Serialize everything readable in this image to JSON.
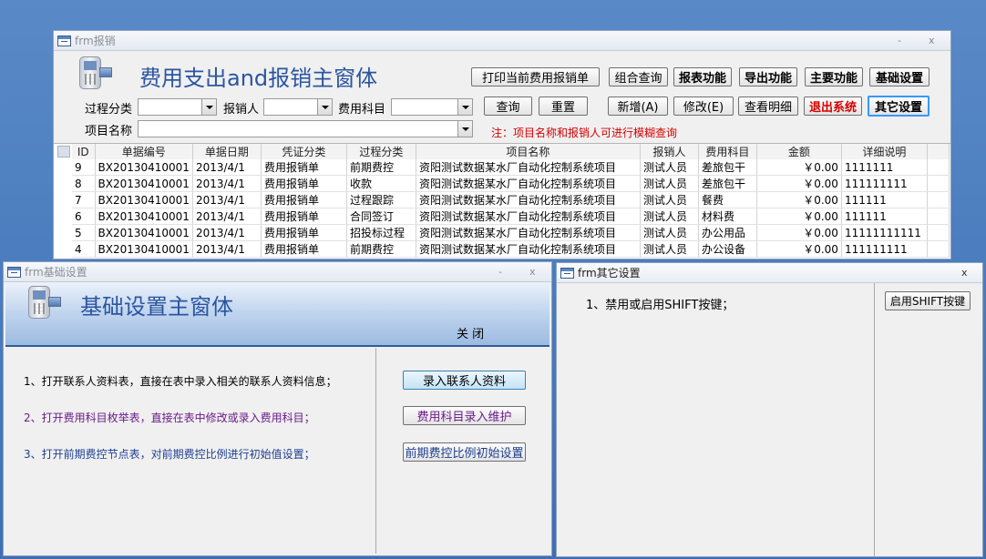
{
  "main_window": {
    "title": "frm报销",
    "ctrl_min": "-",
    "ctrl_close": "x",
    "heading": "费用支出and报销主窗体",
    "top_buttons": [
      "打印当前费用报销单",
      "组合查询",
      "报表功能",
      "导出功能",
      "主要功能",
      "基础设置"
    ],
    "filter": {
      "process_label": "过程分类",
      "reporter_label": "报销人",
      "category_label": "费用科目",
      "project_label": "项目名称",
      "process_value": "",
      "reporter_value": "",
      "category_value": "",
      "project_value": ""
    },
    "actions": {
      "query": "查询",
      "reset": "重置",
      "add": "新增(A)",
      "edit": "修改(E)",
      "details": "查看明细",
      "exit": "退出系统",
      "other": "其它设置"
    },
    "note": "注：项目名称和报销人可进行模糊查询",
    "table": {
      "columns": [
        "ID",
        "单据编号",
        "单据日期",
        "凭证分类",
        "过程分类",
        "项目名称",
        "报销人",
        "费用科目",
        "金额",
        "详细说明"
      ],
      "rows": [
        [
          "9",
          "BX20130410001",
          "2013/4/1",
          "费用报销单",
          "前期费控",
          "资阳测试数据某水厂自动化控制系统项目",
          "测试人员",
          "差旅包干",
          "￥0.00",
          "1111111"
        ],
        [
          "8",
          "BX20130410001",
          "2013/4/1",
          "费用报销单",
          "收款",
          "资阳测试数据某水厂自动化控制系统项目",
          "测试人员",
          "差旅包干",
          "￥0.00",
          "111111111"
        ],
        [
          "7",
          "BX20130410001",
          "2013/4/1",
          "费用报销单",
          "过程跟踪",
          "资阳测试数据某水厂自动化控制系统项目",
          "测试人员",
          "餐费",
          "￥0.00",
          "111111"
        ],
        [
          "6",
          "BX20130410001",
          "2013/4/1",
          "费用报销单",
          "合同签订",
          "资阳测试数据某水厂自动化控制系统项目",
          "测试人员",
          "材料费",
          "￥0.00",
          "111111"
        ],
        [
          "5",
          "BX20130410001",
          "2013/4/1",
          "费用报销单",
          "招投标过程",
          "资阳测试数据某水厂自动化控制系统项目",
          "测试人员",
          "办公用品",
          "￥0.00",
          "11111111111"
        ],
        [
          "4",
          "BX20130410001",
          "2013/4/1",
          "费用报销单",
          "前期费控",
          "资阳测试数据某水厂自动化控制系统项目",
          "测试人员",
          "办公设备",
          "￥0.00",
          "111111111"
        ]
      ]
    }
  },
  "basic_window": {
    "title": "frm基础设置",
    "ctrl_min": "-",
    "ctrl_close": "x",
    "heading": "基础设置主窗体",
    "close_label": "关 闭",
    "items": [
      {
        "text": "1、打开联系人资料表，直接在表中录入相关的联系人资料信息；",
        "button": "录入联系人资料",
        "color": "#000000"
      },
      {
        "text": "2、打开费用科目枚举表，直接在表中修改或录入费用科目；",
        "button": "费用科目录入维护",
        "color": "#6a1b8a"
      },
      {
        "text": "3、打开前期费控节点表，对前期费控比例进行初始值设置；",
        "button": "前期费控比例初始设置",
        "color": "#1f3f8f"
      }
    ]
  },
  "other_window": {
    "title": "frm其它设置",
    "ctrl_close": "x",
    "item": "1、禁用或启用SHIFT按键；",
    "button": "启用SHIFT按键"
  },
  "colors": {
    "heading_blue": "#2b55a0",
    "note_red": "#d40000",
    "exit_red": "#d40000"
  }
}
